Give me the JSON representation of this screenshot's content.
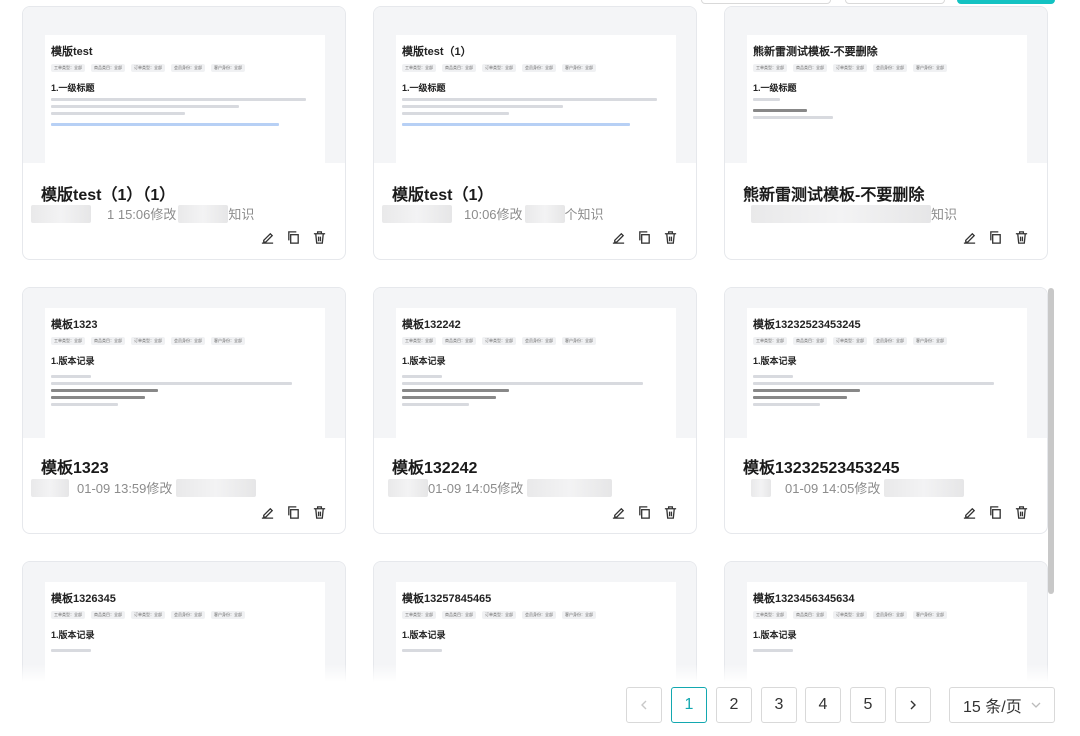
{
  "cards": [
    {
      "title": "模版test（1）（1）",
      "meta": "1 15:06修改",
      "meta_tail": "知识",
      "preview": {
        "title": "模版test",
        "heading": "1.一级标题",
        "chips": [
          "工单类型：全部",
          "商品类目：全部",
          "订单类型：全部",
          "会员身份：全部",
          "客户身份：全部"
        ]
      }
    },
    {
      "title": "模版test（1）",
      "meta": "10:06修改",
      "meta_tail": "个知识",
      "preview": {
        "title": "模版test（1）",
        "heading": "1.一级标题",
        "chips": [
          "工单类型：全部",
          "商品类目：全部",
          "订单类型：全部",
          "会员身份：全部",
          "客户身份：全部"
        ]
      }
    },
    {
      "title": "熊新雷测试模板-不要删除",
      "meta": "",
      "meta_tail": "知识",
      "preview": {
        "title": "熊新雷测试模板-不要删除",
        "heading": "1.一级标题",
        "chips": [
          "工单类型：全部",
          "商品类目：全部",
          "订单类型：全部",
          "会员身份：全部",
          "客户身份：全部"
        ]
      }
    },
    {
      "title": "模板1323",
      "meta": "01-09 13:59修改",
      "meta_tail": "",
      "preview": {
        "title": "模板1323",
        "heading": "1.版本记录",
        "chips": [
          "工单类型：全部",
          "商品类目：全部",
          "订单类型：全部",
          "会员身份：全部",
          "客户身份：全部"
        ]
      }
    },
    {
      "title": "模板132242",
      "meta": "01-09 14:05修改",
      "meta_tail": "",
      "preview": {
        "title": "模板132242",
        "heading": "1.版本记录",
        "chips": [
          "工单类型：全部",
          "商品类目：全部",
          "订单类型：全部",
          "会员身份：全部",
          "客户身份：全部"
        ]
      }
    },
    {
      "title": "模板13232523453245",
      "meta": "01-09 14:05修改",
      "meta_tail": "",
      "preview": {
        "title": "模板13232523453245",
        "heading": "1.版本记录",
        "chips": [
          "工单类型：全部",
          "商品类目：全部",
          "订单类型：全部",
          "会员身份：全部",
          "客户身份：全部"
        ]
      }
    },
    {
      "title": "",
      "meta": "",
      "meta_tail": "",
      "preview": {
        "title": "模板1326345",
        "heading": "1.版本记录",
        "chips": [
          "工单类型：全部",
          "商品类目：全部",
          "订单类型：全部",
          "会员身份：全部",
          "客户身份：全部"
        ]
      }
    },
    {
      "title": "",
      "meta": "",
      "meta_tail": "",
      "preview": {
        "title": "模板13257845465",
        "heading": "1.版本记录",
        "chips": [
          "工单类型：全部",
          "商品类目：全部",
          "订单类型：全部",
          "会员身份：全部",
          "客户身份：全部"
        ]
      }
    },
    {
      "title": "",
      "meta": "",
      "meta_tail": "",
      "preview": {
        "title": "模板1323456345634",
        "heading": "1.版本记录",
        "chips": [
          "工单类型：全部",
          "商品类目：全部",
          "订单类型：全部",
          "会员身份：全部",
          "客户身份：全部"
        ]
      }
    }
  ],
  "pagination": {
    "pages": [
      "1",
      "2",
      "3",
      "4",
      "5"
    ],
    "current_page": "1",
    "page_size_label": "15 条/页"
  },
  "icons": {
    "edit": "edit-icon",
    "copy": "copy-icon",
    "delete": "delete-icon",
    "prev": "chevron-left-icon",
    "next": "chevron-right-icon",
    "dropdown": "chevron-down-icon"
  },
  "colors": {
    "accent": "#13a8b0",
    "primary_button": "#13c2c2"
  }
}
